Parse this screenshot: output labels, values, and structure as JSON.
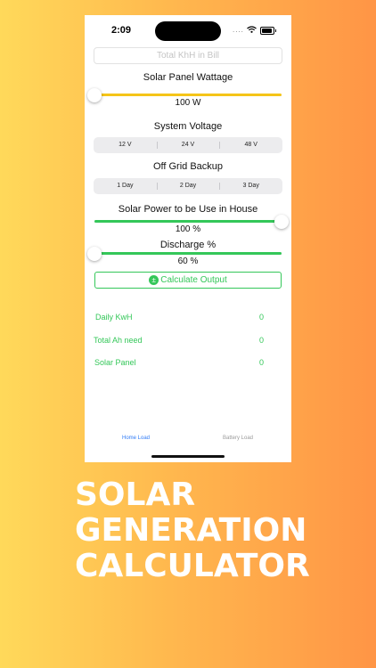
{
  "status_bar": {
    "time": "2:09",
    "signal": "....",
    "icons": [
      "wifi-icon",
      "battery-icon"
    ]
  },
  "bill_input": {
    "placeholder": "Total KhH in Bill",
    "value": ""
  },
  "solar_wattage": {
    "label": "Solar Panel Wattage",
    "value_text": "100 W",
    "slider_fraction": 0.0,
    "color": "#F5C518"
  },
  "system_voltage": {
    "label": "System Voltage",
    "options": [
      "12 V",
      "24 V",
      "48 V"
    ]
  },
  "backup": {
    "label": "Off Grid Backup",
    "options": [
      "1 Day",
      "2 Day",
      "3 Day"
    ]
  },
  "house_power": {
    "label": "Solar Power to be Use in House",
    "value_text": "100 %",
    "slider_fraction": 1.0,
    "color": "#34C759"
  },
  "discharge": {
    "label": "Discharge %",
    "value_text": "60 %",
    "slider_fraction": 0.0,
    "color": "#34C759"
  },
  "calculate": {
    "label": "Calculate Output",
    "icon": "plus-minus-icon"
  },
  "results": [
    {
      "label": "Daily KwH",
      "value": "0"
    },
    {
      "label": "Total Ah need",
      "value": "0"
    },
    {
      "label": "Solar Panel",
      "value": "0"
    }
  ],
  "tabs": [
    {
      "label": "Home Load",
      "active": true
    },
    {
      "label": "Battery Load",
      "active": false
    }
  ],
  "colors": {
    "accent_green": "#34C759",
    "tab_active": "#2F7BF6",
    "tab_inactive": "#9A9A9A",
    "slider_yellow": "#F5C518"
  },
  "promo": {
    "line1": "SOLAR",
    "line2": "GENERATION",
    "line3": "CALCULATOR"
  }
}
